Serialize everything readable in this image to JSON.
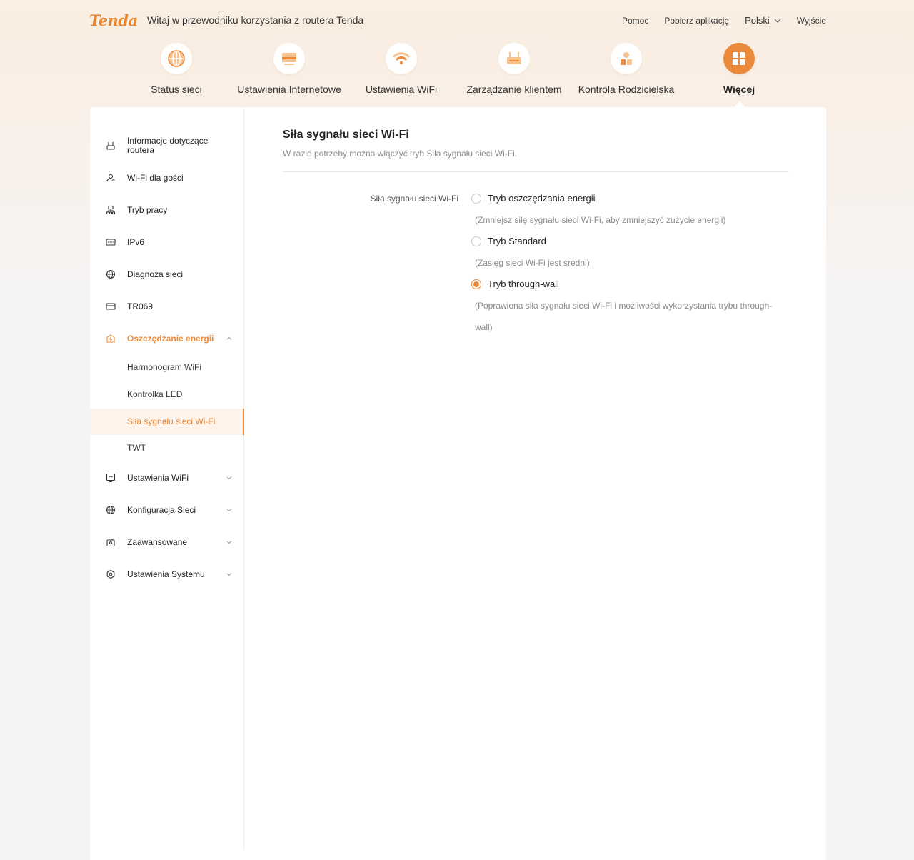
{
  "header": {
    "logo": "Tenda",
    "welcome": "Witaj w przewodniku korzystania z routera Tenda",
    "links": {
      "help": "Pomoc",
      "download": "Pobierz aplikację",
      "language": "Polski",
      "logout": "Wyjście"
    }
  },
  "mainnav": [
    {
      "label": "Status sieci",
      "icon": "globe-icon"
    },
    {
      "label": "Ustawienia Internetowe",
      "icon": "laptop-icon"
    },
    {
      "label": "Ustawienia WiFi",
      "icon": "wifi-icon"
    },
    {
      "label": "Zarządzanie klientem",
      "icon": "router-icon"
    },
    {
      "label": "Kontrola Rodzicielska",
      "icon": "family-icon"
    },
    {
      "label": "Więcej",
      "icon": "grid-icon",
      "active": true
    }
  ],
  "sidebar": {
    "items": [
      {
        "label": "Informacje dotyczące routera",
        "icon": "router-info-icon"
      },
      {
        "label": "Wi-Fi dla gości",
        "icon": "guest-wifi-icon"
      },
      {
        "label": "Tryb pracy",
        "icon": "work-mode-icon"
      },
      {
        "label": "IPv6",
        "icon": "ipv6-icon"
      },
      {
        "label": "Diagnoza sieci",
        "icon": "globe-icon"
      },
      {
        "label": "TR069",
        "icon": "tr069-icon"
      },
      {
        "label": "Oszczędzanie energii",
        "icon": "energy-saving-icon",
        "expanded": true
      },
      {
        "label": "Ustawienia WiFi",
        "icon": "wifi-settings-icon"
      },
      {
        "label": "Konfiguracja Sieci",
        "icon": "globe-icon"
      },
      {
        "label": "Zaawansowane",
        "icon": "advanced-icon"
      },
      {
        "label": "Ustawienia Systemu",
        "icon": "system-settings-icon"
      }
    ],
    "subitems": [
      {
        "label": "Harmonogram WiFi"
      },
      {
        "label": "Kontrolka LED"
      },
      {
        "label": "Siła sygnału sieci Wi-Fi",
        "active": true
      },
      {
        "label": "TWT"
      }
    ]
  },
  "content": {
    "title": "Siła sygnału sieci Wi-Fi",
    "description": "W razie potrzeby można włączyć tryb Siła sygnału sieci Wi-Fi.",
    "field_label": "Siła sygnału sieci Wi-Fi",
    "options": [
      {
        "label": "Tryb oszczędzania energii",
        "hint": "(Zmniejsz siłę sygnału sieci Wi-Fi, aby zmniejszyć zużycie energii)",
        "selected": false
      },
      {
        "label": "Tryb Standard",
        "hint": "(Zasięg sieci Wi-Fi jest średni)",
        "selected": false
      },
      {
        "label": "Tryb through-wall",
        "hint": "(Poprawiona siła sygnału sieci Wi-Fi i możliwości wykorzystania trybu through-wall)",
        "selected": true
      }
    ]
  },
  "colors": {
    "accent": "#ec8a3c",
    "accent_light": "#fdf3ea"
  }
}
